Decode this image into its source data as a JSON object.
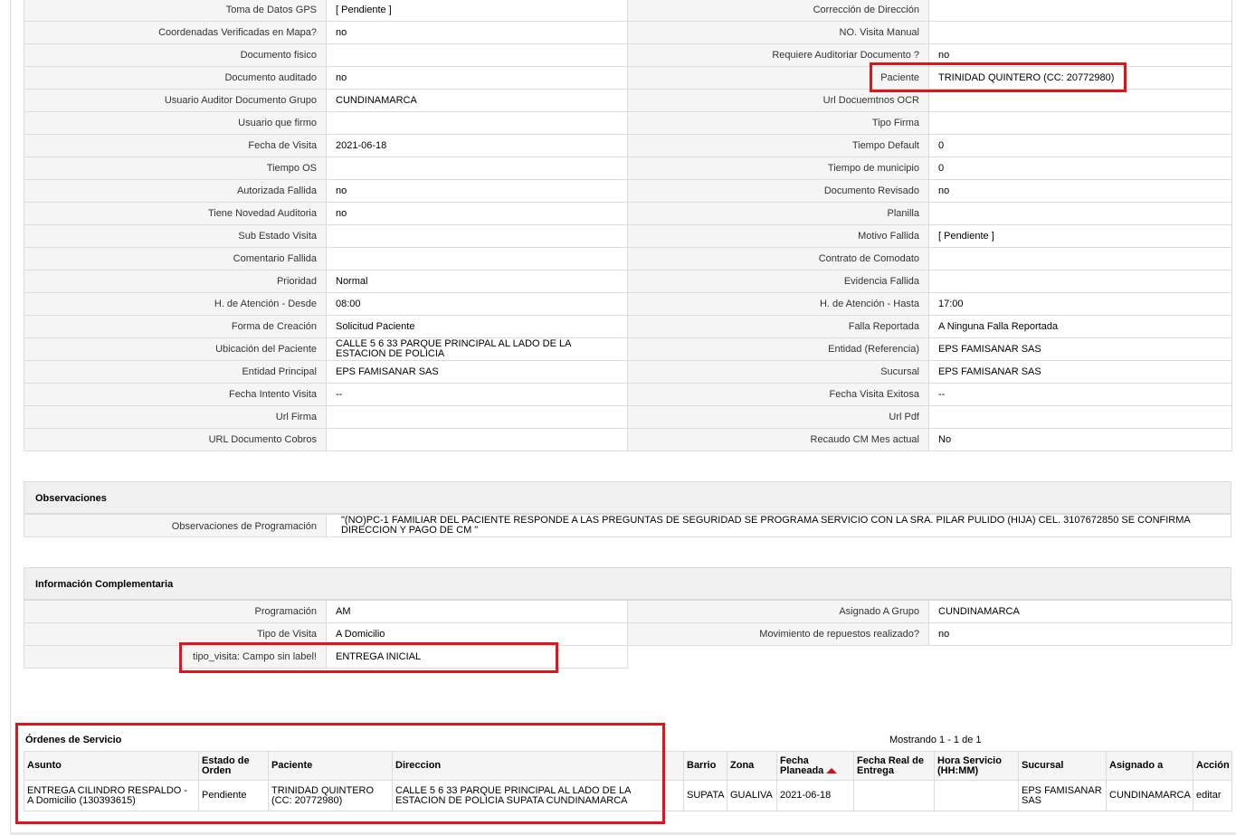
{
  "details": [
    [
      "Toma de Datos GPS",
      "[ Pendiente ]",
      "Corrección de Dirección",
      ""
    ],
    [
      "Coordenadas Verificadas en Mapa?",
      " no",
      "NO. Visita Manual",
      ""
    ],
    [
      "Documento fisico",
      "",
      "Requiere Auditoriar Documento ?",
      " no"
    ],
    [
      "Documento auditado",
      " no",
      "Paciente",
      "TRINIDAD QUINTERO (CC: 20772980)"
    ],
    [
      "Usuario Auditor Documento Grupo",
      "CUNDINAMARCA",
      "Url Docuemtnos OCR",
      ""
    ],
    [
      "Usuario que firmo",
      "",
      "Tipo Firma",
      ""
    ],
    [
      "Fecha de Visita",
      " 2021-06-18",
      "Tiempo Default",
      "0"
    ],
    [
      "Tiempo OS",
      "",
      "Tiempo de municipio",
      "0"
    ],
    [
      "Autorizada Fallida",
      " no",
      "Documento Revisado",
      " no"
    ],
    [
      "Tiene Novedad Auditoria",
      " no",
      "Planilla",
      ""
    ],
    [
      "Sub Estado Visita",
      "",
      "Motivo Fallida",
      "[ Pendiente ]"
    ],
    [
      "Comentario Fallida",
      "",
      "Contrato de Comodato",
      ""
    ],
    [
      "Prioridad",
      "Normal",
      "Evidencia Fallida",
      ""
    ],
    [
      "H. de Atención - Desde",
      "08:00",
      "H. de Atención - Hasta",
      "17:00"
    ],
    [
      "Forma de Creación",
      "Solicitud Paciente",
      "Falla Reportada",
      "A Ninguna Falla Reportada"
    ],
    [
      "Ubicación del Paciente",
      "CALLE 5 6 33 PARQUE PRINCIPAL AL LADO DE LA ESTACION DE POLICIA",
      "Entidad (Referencia)",
      "EPS FAMISANAR SAS"
    ],
    [
      "Entidad Principal",
      "EPS FAMISANAR SAS",
      "Sucursal",
      "EPS FAMISANAR SAS"
    ],
    [
      "Fecha Intento Visita",
      " --",
      "Fecha Visita Exitosa",
      " --"
    ],
    [
      "Url Firma",
      "",
      "Url Pdf",
      ""
    ],
    [
      "URL Documento Cobros",
      "",
      "Recaudo CM Mes actual",
      " No"
    ]
  ],
  "observaciones": {
    "title": "Observaciones",
    "label": "Observaciones de Programación",
    "value": "\"(NO)PC-1 FAMILIAR DEL PACIENTE RESPONDE A LAS PREGUNTAS DE SEGURIDAD SE PROGRAMA SERVICIO CON LA SRA. PILAR PULIDO (HIJA) CEL. 3107672850 SE CONFIRMA DIRECCION Y PAGO DE CM \""
  },
  "complementaria": {
    "title": "Información Complementaria",
    "rows": [
      [
        "Programación",
        "AM",
        "Asignado A Grupo",
        "CUNDINAMARCA"
      ],
      [
        "Tipo de Visita",
        "A Domicilio",
        "Movimiento de repuestos realizado?",
        " no"
      ],
      [
        "tipo_visita: Campo sin label!",
        "ENTREGA INICIAL"
      ]
    ]
  },
  "orders": {
    "title": "Órdenes de Servicio",
    "count": "Mostrando 1 - 1 de 1",
    "headers": [
      "Asunto",
      "Estado de Orden",
      "Paciente",
      "Direccion",
      "Barrio",
      "Zona",
      "Fecha Planeada",
      "Fecha Real de Entrega",
      "Hora Servicio (HH:MM)",
      "Sucursal",
      "Asignado a",
      "Acción"
    ],
    "rows": [
      [
        "ENTREGA CILINDRO RESPALDO - A Domicilio (130393615)",
        "Pendiente",
        "TRINIDAD QUINTERO (CC: 20772980)",
        "CALLE 5 6 33 PARQUE PRINCIPAL AL LADO DE LA ESTACION DE POLICIA SUPATA CUNDINAMARCA",
        "SUPATA",
        "GUALIVA",
        "2021-06-18",
        "",
        "",
        "EPS FAMISANAR SAS",
        "CUNDINAMARCA",
        "editar"
      ]
    ]
  },
  "colors": {
    "highlight": "#e1141b",
    "label_bg": "#f5f5f5",
    "border": "#dcdcdc"
  }
}
